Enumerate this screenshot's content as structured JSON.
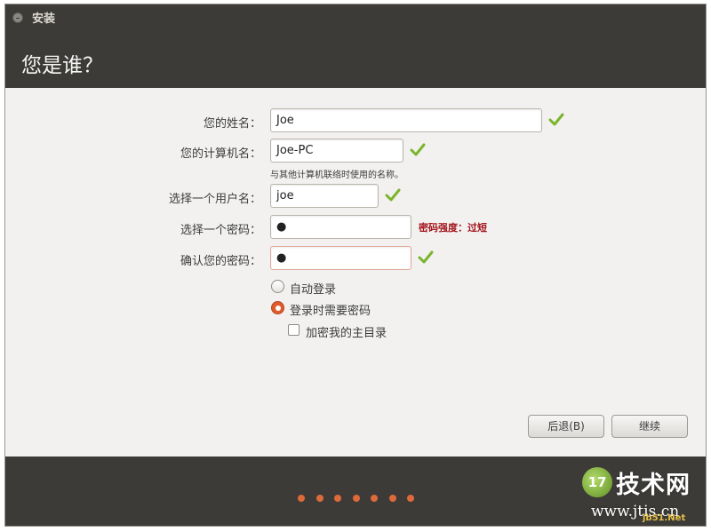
{
  "window": {
    "title": "安装",
    "heading": "您是谁？"
  },
  "form": {
    "name_label": "您的姓名：",
    "name_value": "Joe",
    "computer_label": "您的计算机名：",
    "computer_value": "Joe-PC",
    "computer_hint": "与其他计算机联络时使用的名称。",
    "username_label": "选择一个用户名：",
    "username_value": "joe",
    "password_label": "选择一个密码：",
    "password_value": "●",
    "password_strength": "密码强度：过短",
    "confirm_label": "确认您的密码：",
    "confirm_value": "●"
  },
  "options": {
    "auto_login": "自动登录",
    "require_password": "登录时需要密码",
    "encrypt_home": "加密我的主目录",
    "selected": "require_password",
    "encrypt_checked": false
  },
  "buttons": {
    "back": "后退(B)",
    "continue": "继续"
  },
  "progress": {
    "dots": 7
  },
  "watermark": {
    "logo_number": "17",
    "brand": "技术网",
    "domain": "www.jtis.cn",
    "sub": "jb51.Net"
  },
  "colors": {
    "titlebar": "#3c3b37",
    "accent": "#dd6a3a",
    "check": "#7bb52c",
    "strength_text": "#a4141c"
  }
}
